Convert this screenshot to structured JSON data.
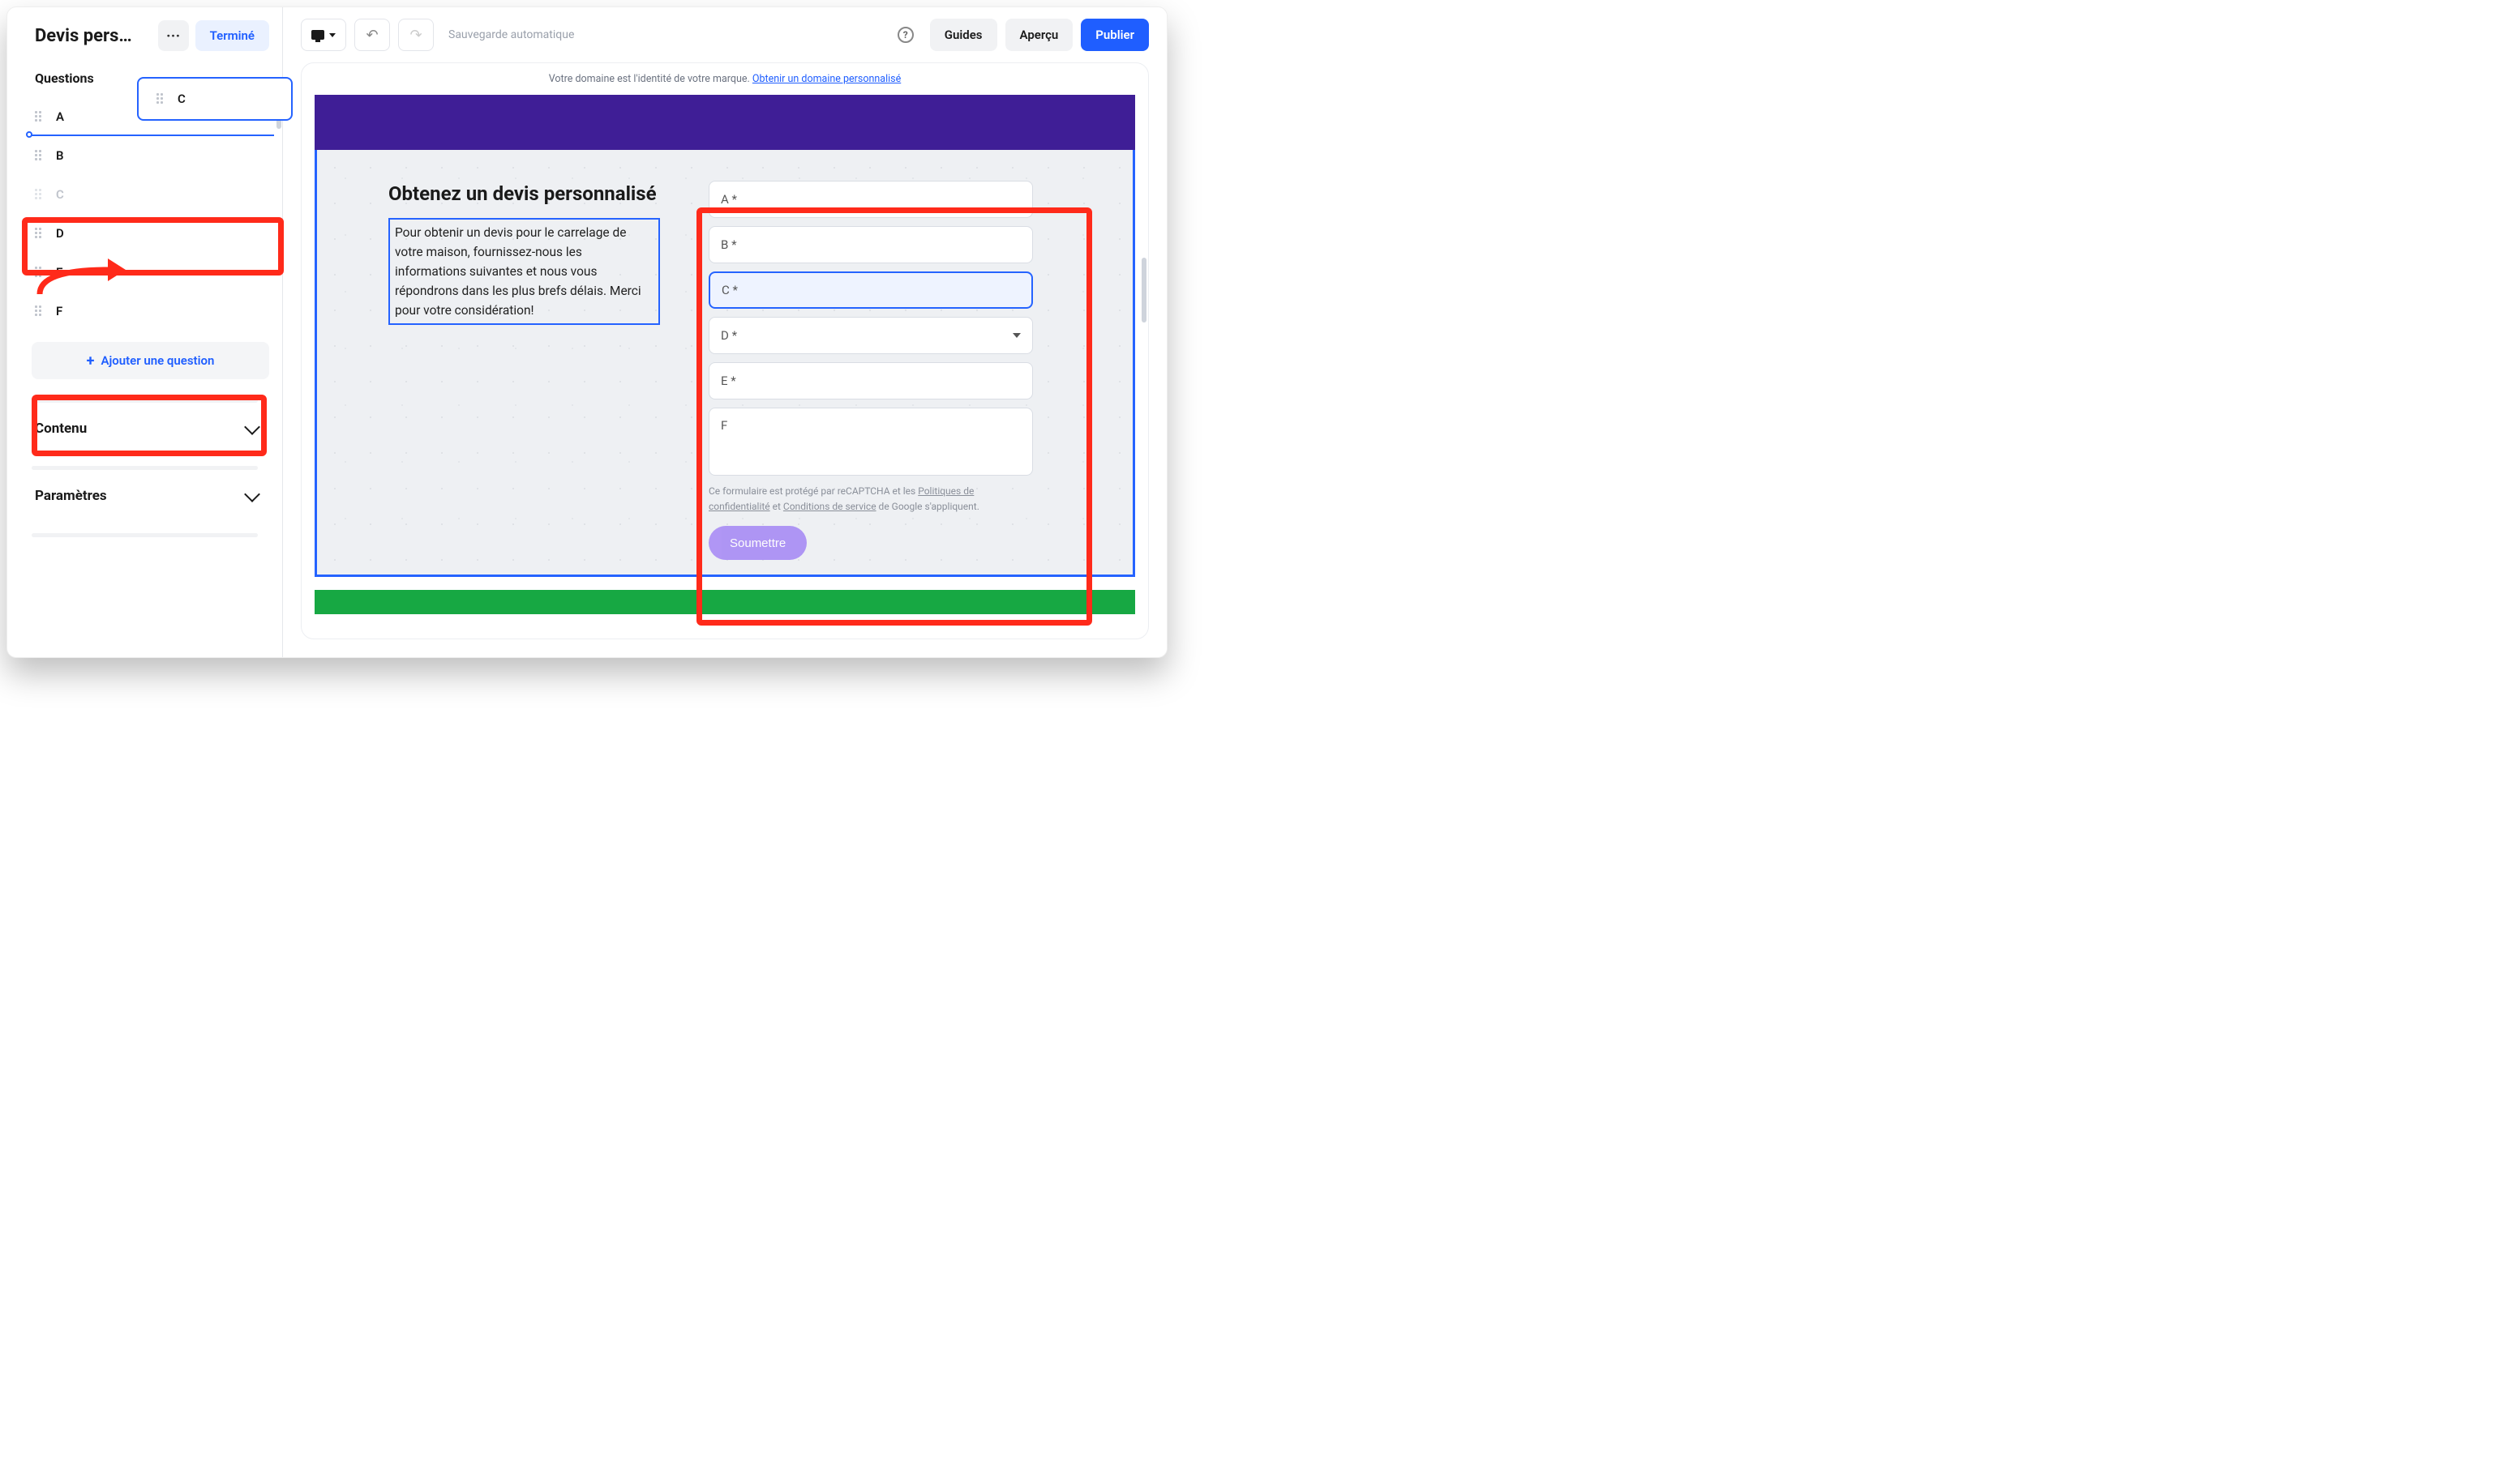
{
  "sidebar": {
    "title": "Devis pers…",
    "done": "Terminé",
    "section": "Questions",
    "items": [
      "A",
      "B",
      "C",
      "D",
      "E",
      "F"
    ],
    "floating": "C",
    "add": "Ajouter une question",
    "accordions": [
      "Contenu",
      "Paramètres"
    ]
  },
  "toolbar": {
    "autosave": "Sauvegarde automatique",
    "guides": "Guides",
    "preview": "Aperçu",
    "publish": "Publier"
  },
  "banner": {
    "text": "Votre domaine est l'identité de votre marque. ",
    "link": "Obtenir un domaine personnalisé"
  },
  "form": {
    "title": "Obtenez un devis personnalisé",
    "desc": "Pour obtenir un devis pour le carrelage de votre maison, fournissez-nous les informations suivantes et nous vous répondrons dans les plus brefs délais. Merci pour votre considération!",
    "fields": {
      "a": "A *",
      "b": "B *",
      "c": "C *",
      "d": "D *",
      "e": "E *",
      "f": "F"
    },
    "recaptcha_pre": "Ce formulaire est protégé par reCAPTCHA et les ",
    "recaptcha_link1": "Politiques de confidentialité",
    "recaptcha_mid": " et ",
    "recaptcha_link2": "Conditions de service",
    "recaptcha_post": " de Google s'appliquent.",
    "submit": "Soumettre"
  }
}
